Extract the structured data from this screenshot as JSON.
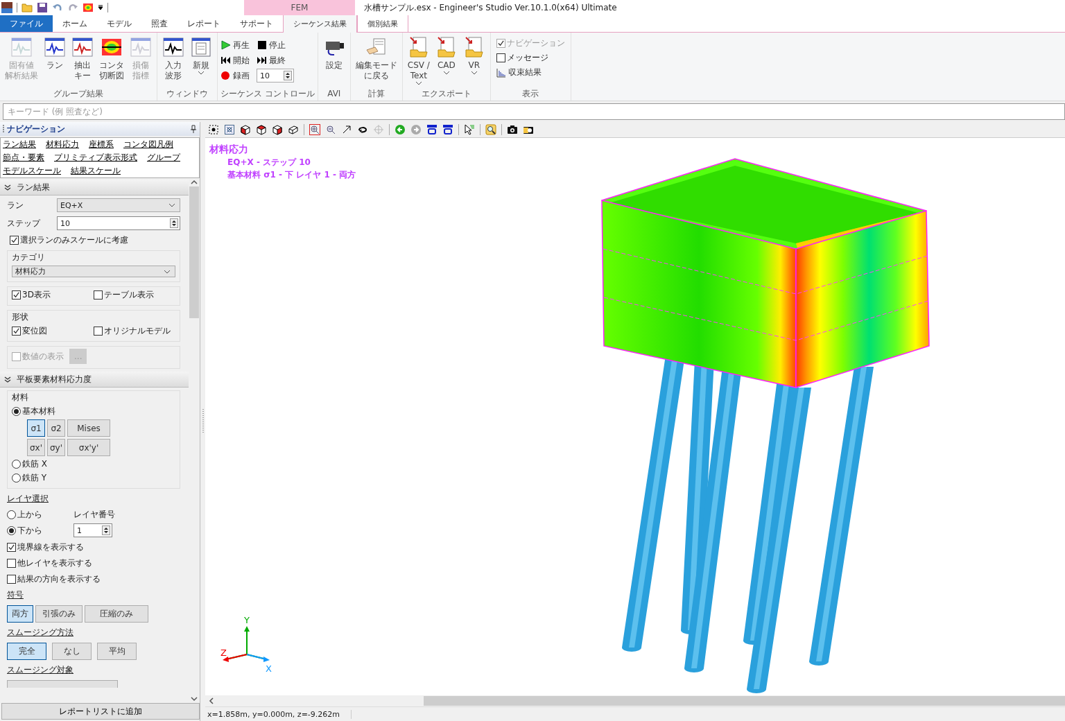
{
  "window": {
    "title": "水槽サンプル.esx - Engineer's Studio Ver.10.1.0(x64) Ultimate",
    "context_group": "FEM"
  },
  "ribbon_tabs": [
    {
      "label": "ファイル",
      "kind": "file",
      "selected": false
    },
    {
      "label": "ホーム",
      "kind": "normal",
      "selected": false
    },
    {
      "label": "モデル",
      "kind": "normal",
      "selected": false
    },
    {
      "label": "照査",
      "kind": "normal",
      "selected": false
    },
    {
      "label": "レポート",
      "kind": "normal",
      "selected": false
    },
    {
      "label": "サポート",
      "kind": "normal",
      "selected": false
    },
    {
      "label": "シーケンス結果",
      "kind": "context",
      "selected": true
    },
    {
      "label": "個別結果",
      "kind": "context",
      "selected": false
    }
  ],
  "ribbon_groups": [
    {
      "label": "グループ結果",
      "items": [
        {
          "kind": "large",
          "lines": [
            "固有値",
            "解析結果"
          ],
          "disabled": true
        },
        {
          "kind": "large",
          "lines": [
            "ラン"
          ],
          "disabled": false
        },
        {
          "kind": "large",
          "lines": [
            "抽出",
            "キー"
          ],
          "disabled": false
        },
        {
          "kind": "large",
          "lines": [
            "コンタ",
            "切断図"
          ],
          "disabled": false
        },
        {
          "kind": "large",
          "lines": [
            "損傷",
            "指標"
          ],
          "disabled": true
        }
      ]
    },
    {
      "label": "ウィンドウ",
      "items": [
        {
          "kind": "large",
          "lines": [
            "入力",
            "波形"
          ],
          "disabled": false
        },
        {
          "kind": "large",
          "lines": [
            "新規"
          ],
          "disabled": false,
          "dropdown": true
        }
      ]
    },
    {
      "label": "シーケンス コントロール",
      "items": [
        {
          "kind": "small",
          "label": "再生"
        },
        {
          "kind": "small",
          "label": "停止"
        },
        {
          "kind": "small",
          "label": "開始"
        },
        {
          "kind": "small",
          "label": "最終"
        },
        {
          "kind": "small",
          "label": "録画"
        },
        {
          "kind": "spin",
          "value": "10"
        }
      ]
    },
    {
      "label": "AVI",
      "items": [
        {
          "kind": "large",
          "lines": [
            "設定"
          ],
          "disabled": false
        }
      ]
    },
    {
      "label": "計算",
      "items": [
        {
          "kind": "large",
          "lines": [
            "編集モード",
            "に戻る"
          ],
          "disabled": false
        }
      ]
    },
    {
      "label": "エクスポート",
      "items": [
        {
          "kind": "large",
          "lines": [
            "CSV /",
            "Text"
          ],
          "disabled": false,
          "dropdown": true
        },
        {
          "kind": "large",
          "lines": [
            "CAD"
          ],
          "disabled": false,
          "dropdown": true
        },
        {
          "kind": "large",
          "lines": [
            "VR"
          ],
          "disabled": false,
          "dropdown": true
        }
      ]
    },
    {
      "label": "表示",
      "items": [
        {
          "kind": "check",
          "label": "ナビゲーション",
          "checked": true,
          "disabled": true
        },
        {
          "kind": "check",
          "label": "メッセージ",
          "checked": false,
          "disabled": false
        },
        {
          "kind": "small",
          "label": "収束結果"
        }
      ]
    }
  ],
  "search": {
    "placeholder": "キーワード (例 照査など)"
  },
  "navigation": {
    "title": "ナビゲーション",
    "links": [
      "ラン結果",
      "材料応力",
      "座標系",
      "コンタ図凡例",
      "節点・要素",
      "プリミティブ表示形式",
      "グループ",
      "モデルスケール",
      "結果スケール"
    ],
    "run_section": {
      "title": "ラン結果",
      "expanded": true,
      "run": {
        "label": "ラン",
        "value": "EQ+X"
      },
      "step": {
        "label": "ステップ",
        "value": "10"
      },
      "scale_check": {
        "label": "選択ランのみスケールに考慮",
        "checked": true
      },
      "category": {
        "title": "カテゴリ",
        "value": "材料応力"
      },
      "view_checks": [
        {
          "label": "3D表示",
          "checked": true
        },
        {
          "label": "テーブル表示",
          "checked": false
        }
      ],
      "shape": {
        "title": "形状",
        "checks": [
          {
            "label": "変位図",
            "checked": true
          },
          {
            "label": "オリジナルモデル",
            "checked": false
          }
        ]
      },
      "values": {
        "label": "数値の表示",
        "checked": false,
        "disabled": true,
        "button": "..."
      }
    },
    "plate_section": {
      "title": "平板要素材料応力度",
      "expanded": true,
      "material": {
        "title": "材料",
        "options": [
          {
            "label": "基本材料",
            "selected": true
          },
          {
            "label": "鉄筋 X",
            "selected": false
          },
          {
            "label": "鉄筋 Y",
            "selected": false
          }
        ],
        "components": [
          {
            "label": "σ1",
            "selected": true
          },
          {
            "label": "σ2",
            "selected": false
          },
          {
            "label": "Mises",
            "selected": false
          },
          {
            "label": "σx'",
            "selected": false
          },
          {
            "label": "σy'",
            "selected": false
          },
          {
            "label": "σx'y'",
            "selected": false
          }
        ]
      },
      "layer": {
        "title": "レイヤ選択",
        "options": [
          {
            "label": "上から",
            "selected": false
          },
          {
            "label": "下から",
            "selected": true
          }
        ],
        "number_label": "レイヤ番号",
        "number": "1"
      },
      "display_checks": [
        {
          "label": "境界線を表示する",
          "checked": true
        },
        {
          "label": "他レイヤを表示する",
          "checked": false
        },
        {
          "label": "結果の方向を表示する",
          "checked": false
        }
      ],
      "sign": {
        "title": "符号",
        "buttons": [
          {
            "label": "両方",
            "selected": true
          },
          {
            "label": "引張のみ",
            "selected": false
          },
          {
            "label": "圧縮のみ",
            "selected": false
          }
        ]
      },
      "smoothing": {
        "title": "スムージング方法",
        "buttons": [
          {
            "label": "完全",
            "selected": true
          },
          {
            "label": "なし",
            "selected": false
          },
          {
            "label": "平均",
            "selected": false
          }
        ]
      },
      "smoothing_target": {
        "title": "スムージング対象"
      }
    }
  },
  "report_button": "レポートリストに追加",
  "viewport": {
    "title": "材料応力",
    "lines": [
      "EQ+X - ステップ 10",
      "基本材料 σ1 - 下 レイヤ 1 - 両方"
    ],
    "axes": {
      "y": "Y",
      "z": "Z",
      "x": "X"
    }
  },
  "status_bar": {
    "coordinates": "x=1.858m, y=0.000m, z=-9.262m"
  }
}
